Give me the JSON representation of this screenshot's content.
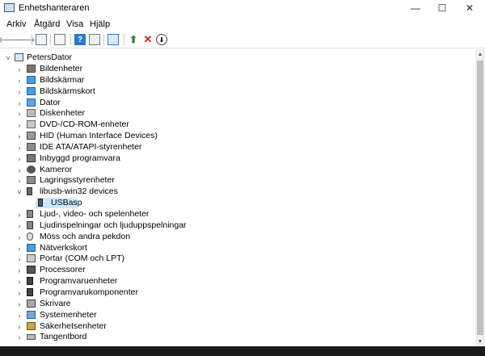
{
  "window": {
    "title": "Enhetshanteraren",
    "minimize": "—",
    "maximize": "☐",
    "close": "✕"
  },
  "menu": [
    "Arkiv",
    "Åtgärd",
    "Visa",
    "Hjälp"
  ],
  "toolbar": {
    "back": "🡐",
    "forward": "🡒"
  },
  "tree": {
    "root": "PetersDator",
    "items": [
      {
        "label": "Bildenheter",
        "icon": "camera-icon"
      },
      {
        "label": "Bildskärmar",
        "icon": "monitor-icon"
      },
      {
        "label": "Bildskärmskort",
        "icon": "display-adapter-icon"
      },
      {
        "label": "Dator",
        "icon": "computer-icon"
      },
      {
        "label": "Diskenheter",
        "icon": "disk-icon"
      },
      {
        "label": "DVD-/CD-ROM-enheter",
        "icon": "dvd-icon"
      },
      {
        "label": "HID (Human Interface Devices)",
        "icon": "hid-icon"
      },
      {
        "label": "IDE ATA/ATAPI-styrenheter",
        "icon": "ide-icon"
      },
      {
        "label": "Inbyggd programvara",
        "icon": "firmware-icon"
      },
      {
        "label": "Kameror",
        "icon": "webcam-icon"
      },
      {
        "label": "Lagringsstyrenheter",
        "icon": "storage-controller-icon"
      },
      {
        "label": "libusb-win32 devices",
        "icon": "usb-device-icon",
        "expanded": true,
        "children": [
          {
            "label": "USBasp",
            "icon": "usb-plug-icon"
          }
        ]
      },
      {
        "label": "Ljud-, video- och spelenheter",
        "icon": "speaker-icon"
      },
      {
        "label": "Ljudinspelningar och ljuduppspelningar",
        "icon": "audio-icon"
      },
      {
        "label": "Möss och andra pekdon",
        "icon": "mouse-icon"
      },
      {
        "label": "Nätverkskort",
        "icon": "network-icon"
      },
      {
        "label": "Portar (COM och LPT)",
        "icon": "port-icon"
      },
      {
        "label": "Processorer",
        "icon": "processor-icon"
      },
      {
        "label": "Programvaruenheter",
        "icon": "software-device-icon"
      },
      {
        "label": "Programvarukomponenter",
        "icon": "software-component-icon"
      },
      {
        "label": "Skrivare",
        "icon": "printer-icon"
      },
      {
        "label": "Systemenheter",
        "icon": "system-device-icon"
      },
      {
        "label": "Säkerhetsenheter",
        "icon": "security-device-icon"
      },
      {
        "label": "Tangentbord",
        "icon": "keyboard-icon"
      }
    ]
  },
  "colors": {
    "selection": "#cce8ff",
    "accent_blue": "#2b78d3",
    "delete_red": "#d42020",
    "add_green": "#2d8a2d"
  }
}
